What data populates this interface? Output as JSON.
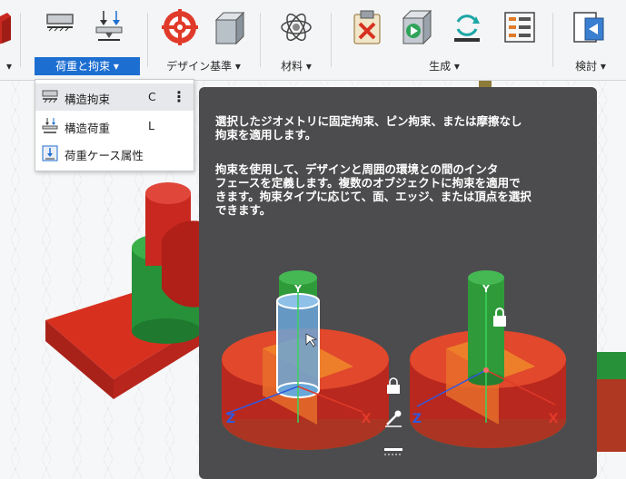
{
  "toolbar": {
    "groups": [
      {
        "label": "荷重と拘束 ▾"
      },
      {
        "label": "デザイン基準 ▾"
      },
      {
        "label": "材料 ▾"
      },
      {
        "label": "生成 ▾"
      },
      {
        "label": "検討 ▾"
      }
    ],
    "left_group_caret": "▾"
  },
  "dropdown": {
    "items": [
      {
        "label": "構造拘束",
        "shortcut": "C",
        "icon": "structural-constraint-icon"
      },
      {
        "label": "構造荷重",
        "shortcut": "L",
        "icon": "structural-load-icon"
      },
      {
        "label": "荷重ケース属性",
        "shortcut": "",
        "icon": "load-case-attributes-icon"
      }
    ],
    "more_glyph": "⋮"
  },
  "tooltip": {
    "paragraph1": "選択したジオメトリに固定拘束、ピン拘束、または摩擦なし\n拘束を適用します。",
    "paragraph2": "拘束を使用して、デザインと周囲の環境との間のインタ\nフェースを定義します。複数のオブジェクトに拘束を適用で\nきます。拘束タイプに応じて、面、エッジ、または頂点を選択\nできます。",
    "illustration": {
      "left_axis_z": "Z",
      "left_axis_x": "X",
      "left_axis_y": "Y",
      "right_axis_z": "Z",
      "right_axis_x": "X",
      "right_axis_y": "Y"
    }
  },
  "colors": {
    "accent": "#1d6ed1",
    "tooltip_bg": "#4c4c4e",
    "model_red": "#c8281f",
    "model_green": "#2f9a3a"
  }
}
